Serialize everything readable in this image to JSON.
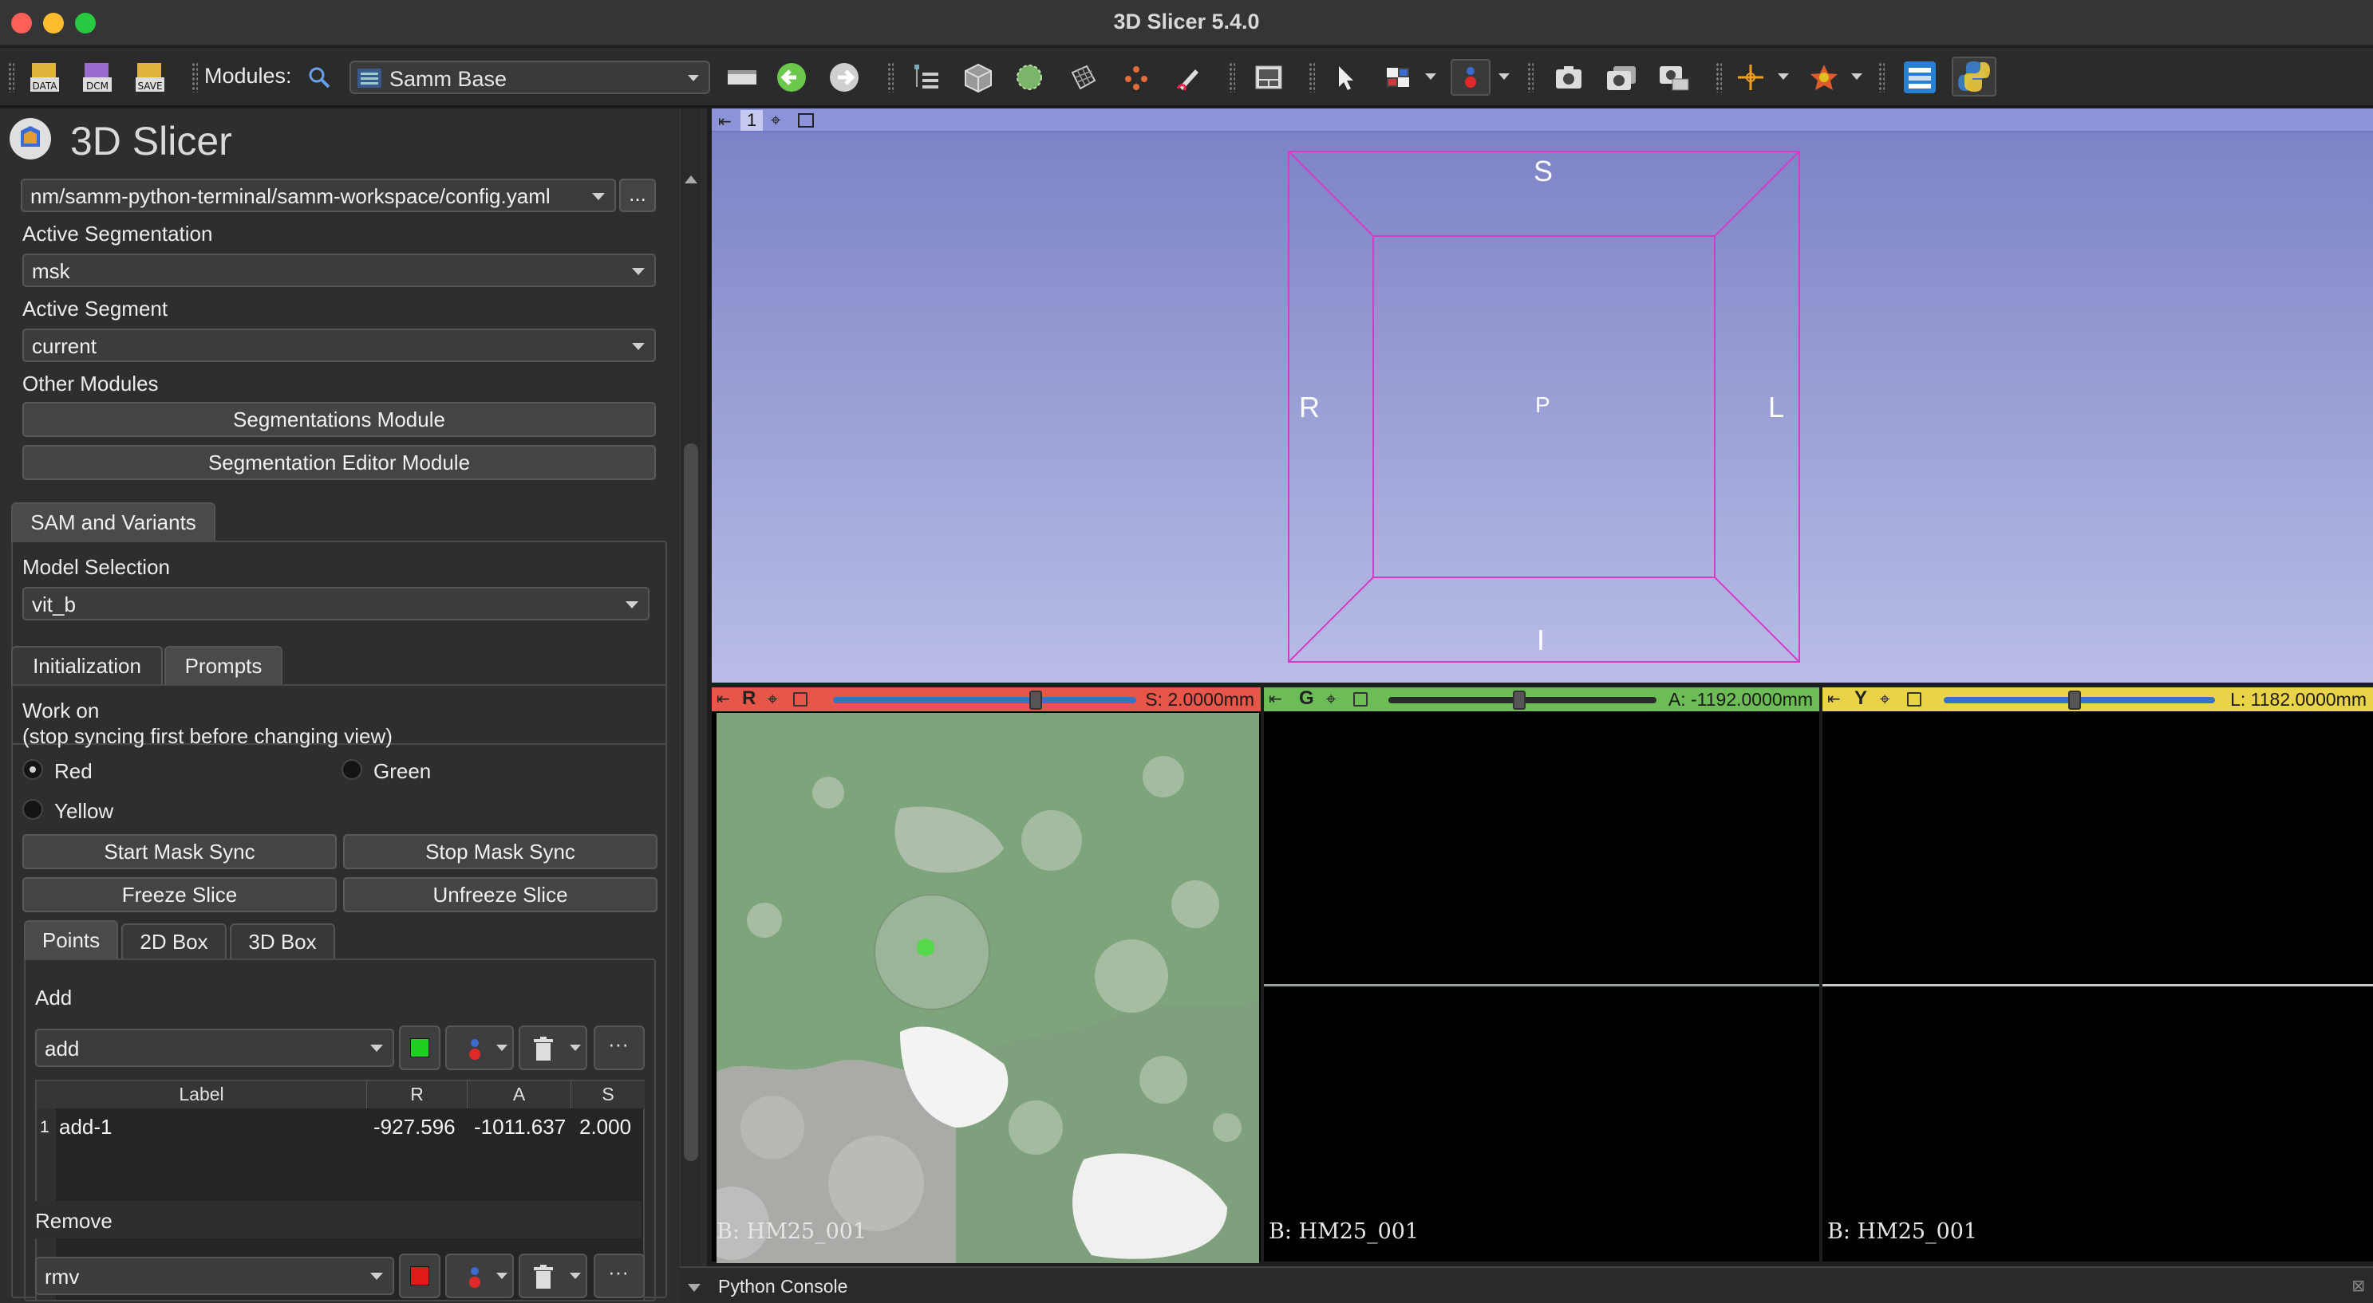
{
  "window": {
    "title": "3D Slicer 5.4.0"
  },
  "toolbar": {
    "data_label": "DATA",
    "dcm_label": "DCM",
    "save_label": "SAVE",
    "modules_label": "Modules:",
    "module_selected": "Samm Base"
  },
  "brand": {
    "name": "3D Slicer"
  },
  "config": {
    "path": "nm/samm-python-terminal/samm-workspace/config.yaml",
    "browse_label": "..."
  },
  "segmentation": {
    "active_segmentation_label": "Active Segmentation",
    "active_segmentation_value": "msk",
    "active_segment_label": "Active Segment",
    "active_segment_value": "current",
    "other_modules_label": "Other Modules",
    "segmentations_module_button": "Segmentations Module",
    "segmentation_editor_button": "Segmentation Editor Module"
  },
  "sam": {
    "tab_label": "SAM and Variants",
    "model_selection_label": "Model Selection",
    "model_value": "vit_b"
  },
  "prompts": {
    "tab_initialization": "Initialization",
    "tab_prompts": "Prompts",
    "work_on_label": "Work on",
    "work_on_hint": "(stop syncing first before changing view)",
    "radio_red": "Red",
    "radio_green": "Green",
    "radio_yellow": "Yellow",
    "start_mask_sync": "Start Mask Sync",
    "stop_mask_sync": "Stop Mask Sync",
    "freeze_slice": "Freeze Slice",
    "unfreeze_slice": "Unfreeze Slice",
    "subtab_points": "Points",
    "subtab_2dbox": "2D Box",
    "subtab_3dbox": "3D Box",
    "add_label": "Add",
    "add_value": "add",
    "table_headers": [
      "Label",
      "R",
      "A",
      "S"
    ],
    "rows": [
      {
        "index": "1",
        "label": "add-1",
        "r": "-927.596",
        "a": "-1011.637",
        "s": "2.000"
      }
    ],
    "remove_label": "Remove",
    "remove_value": "rmv"
  },
  "view3d": {
    "layout_number": "1",
    "orientation": {
      "top": "S",
      "bottom": "I",
      "left": "R",
      "right": "L",
      "center": "P"
    }
  },
  "slices": [
    {
      "letter": "R",
      "offset": "S: 2.0000mm",
      "background": "B: HM25_001",
      "color": "#e8564a"
    },
    {
      "letter": "G",
      "offset": "A: -1192.0000mm",
      "background": "B: HM25_001",
      "color": "#6cbd55"
    },
    {
      "letter": "Y",
      "offset": "L: 1182.0000mm",
      "background": "B: HM25_001",
      "color": "#e9d349"
    }
  ],
  "console": {
    "label": "Python Console"
  }
}
